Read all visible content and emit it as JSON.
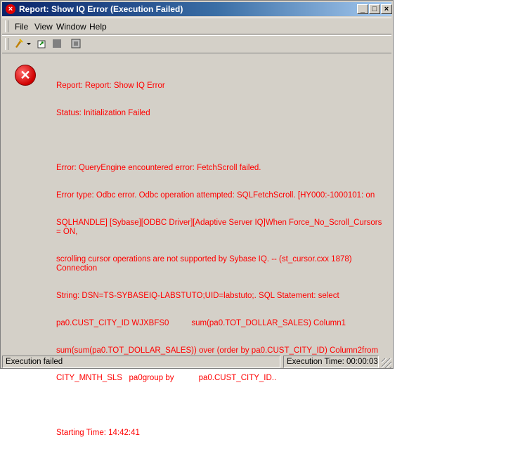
{
  "window": {
    "title": "Report: Show IQ Error (Execution Failed)",
    "controls": {
      "minimize": "_",
      "maximize": "□",
      "close": "×"
    }
  },
  "menubar": {
    "items": [
      "File",
      "View",
      "Window",
      "Help"
    ]
  },
  "toolbar": {
    "icons": [
      "run-report-icon",
      "dropdown-arrow-icon",
      "export-icon",
      "stop-icon",
      "print-preview-icon"
    ]
  },
  "error": {
    "lines": [
      "Report: Report: Show IQ Error",
      "Status: Initialization Failed",
      "",
      "Error: QueryEngine encountered error: FetchScroll failed.",
      "Error type: Odbc error. Odbc operation attempted: SQLFetchScroll. [HY000:-1000101: on",
      "SQLHANDLE] [Sybase][ODBC Driver][Adaptive Server IQ]When Force_No_Scroll_Cursors = ON,",
      "scrolling cursor operations are not supported by Sybase IQ. -- (st_cursor.cxx 1878)  Connection",
      "String: DSN=TS-SYBASEIQ-LABSTUTO;UID=labstuto;. SQL Statement: select",
      "pa0.CUST_CITY_ID WJXBFS0          sum(pa0.TOT_DOLLAR_SALES) Column1",
      "sum(sum(pa0.TOT_DOLLAR_SALES)) over (order by pa0.CUST_CITY_ID) Column2from",
      "CITY_MNTH_SLS   pa0group by           pa0.CUST_CITY_ID..",
      "",
      "Starting Time: 14:42:41"
    ],
    "text_color": "#ff0000"
  },
  "statusbar": {
    "left": "Execution failed",
    "right": "Execution Time: 00:00:03"
  },
  "colors": {
    "titlebar_start": "#0a246a",
    "titlebar_end": "#a6caf0",
    "face": "#d4d0c8",
    "error_icon": "#d00000"
  }
}
